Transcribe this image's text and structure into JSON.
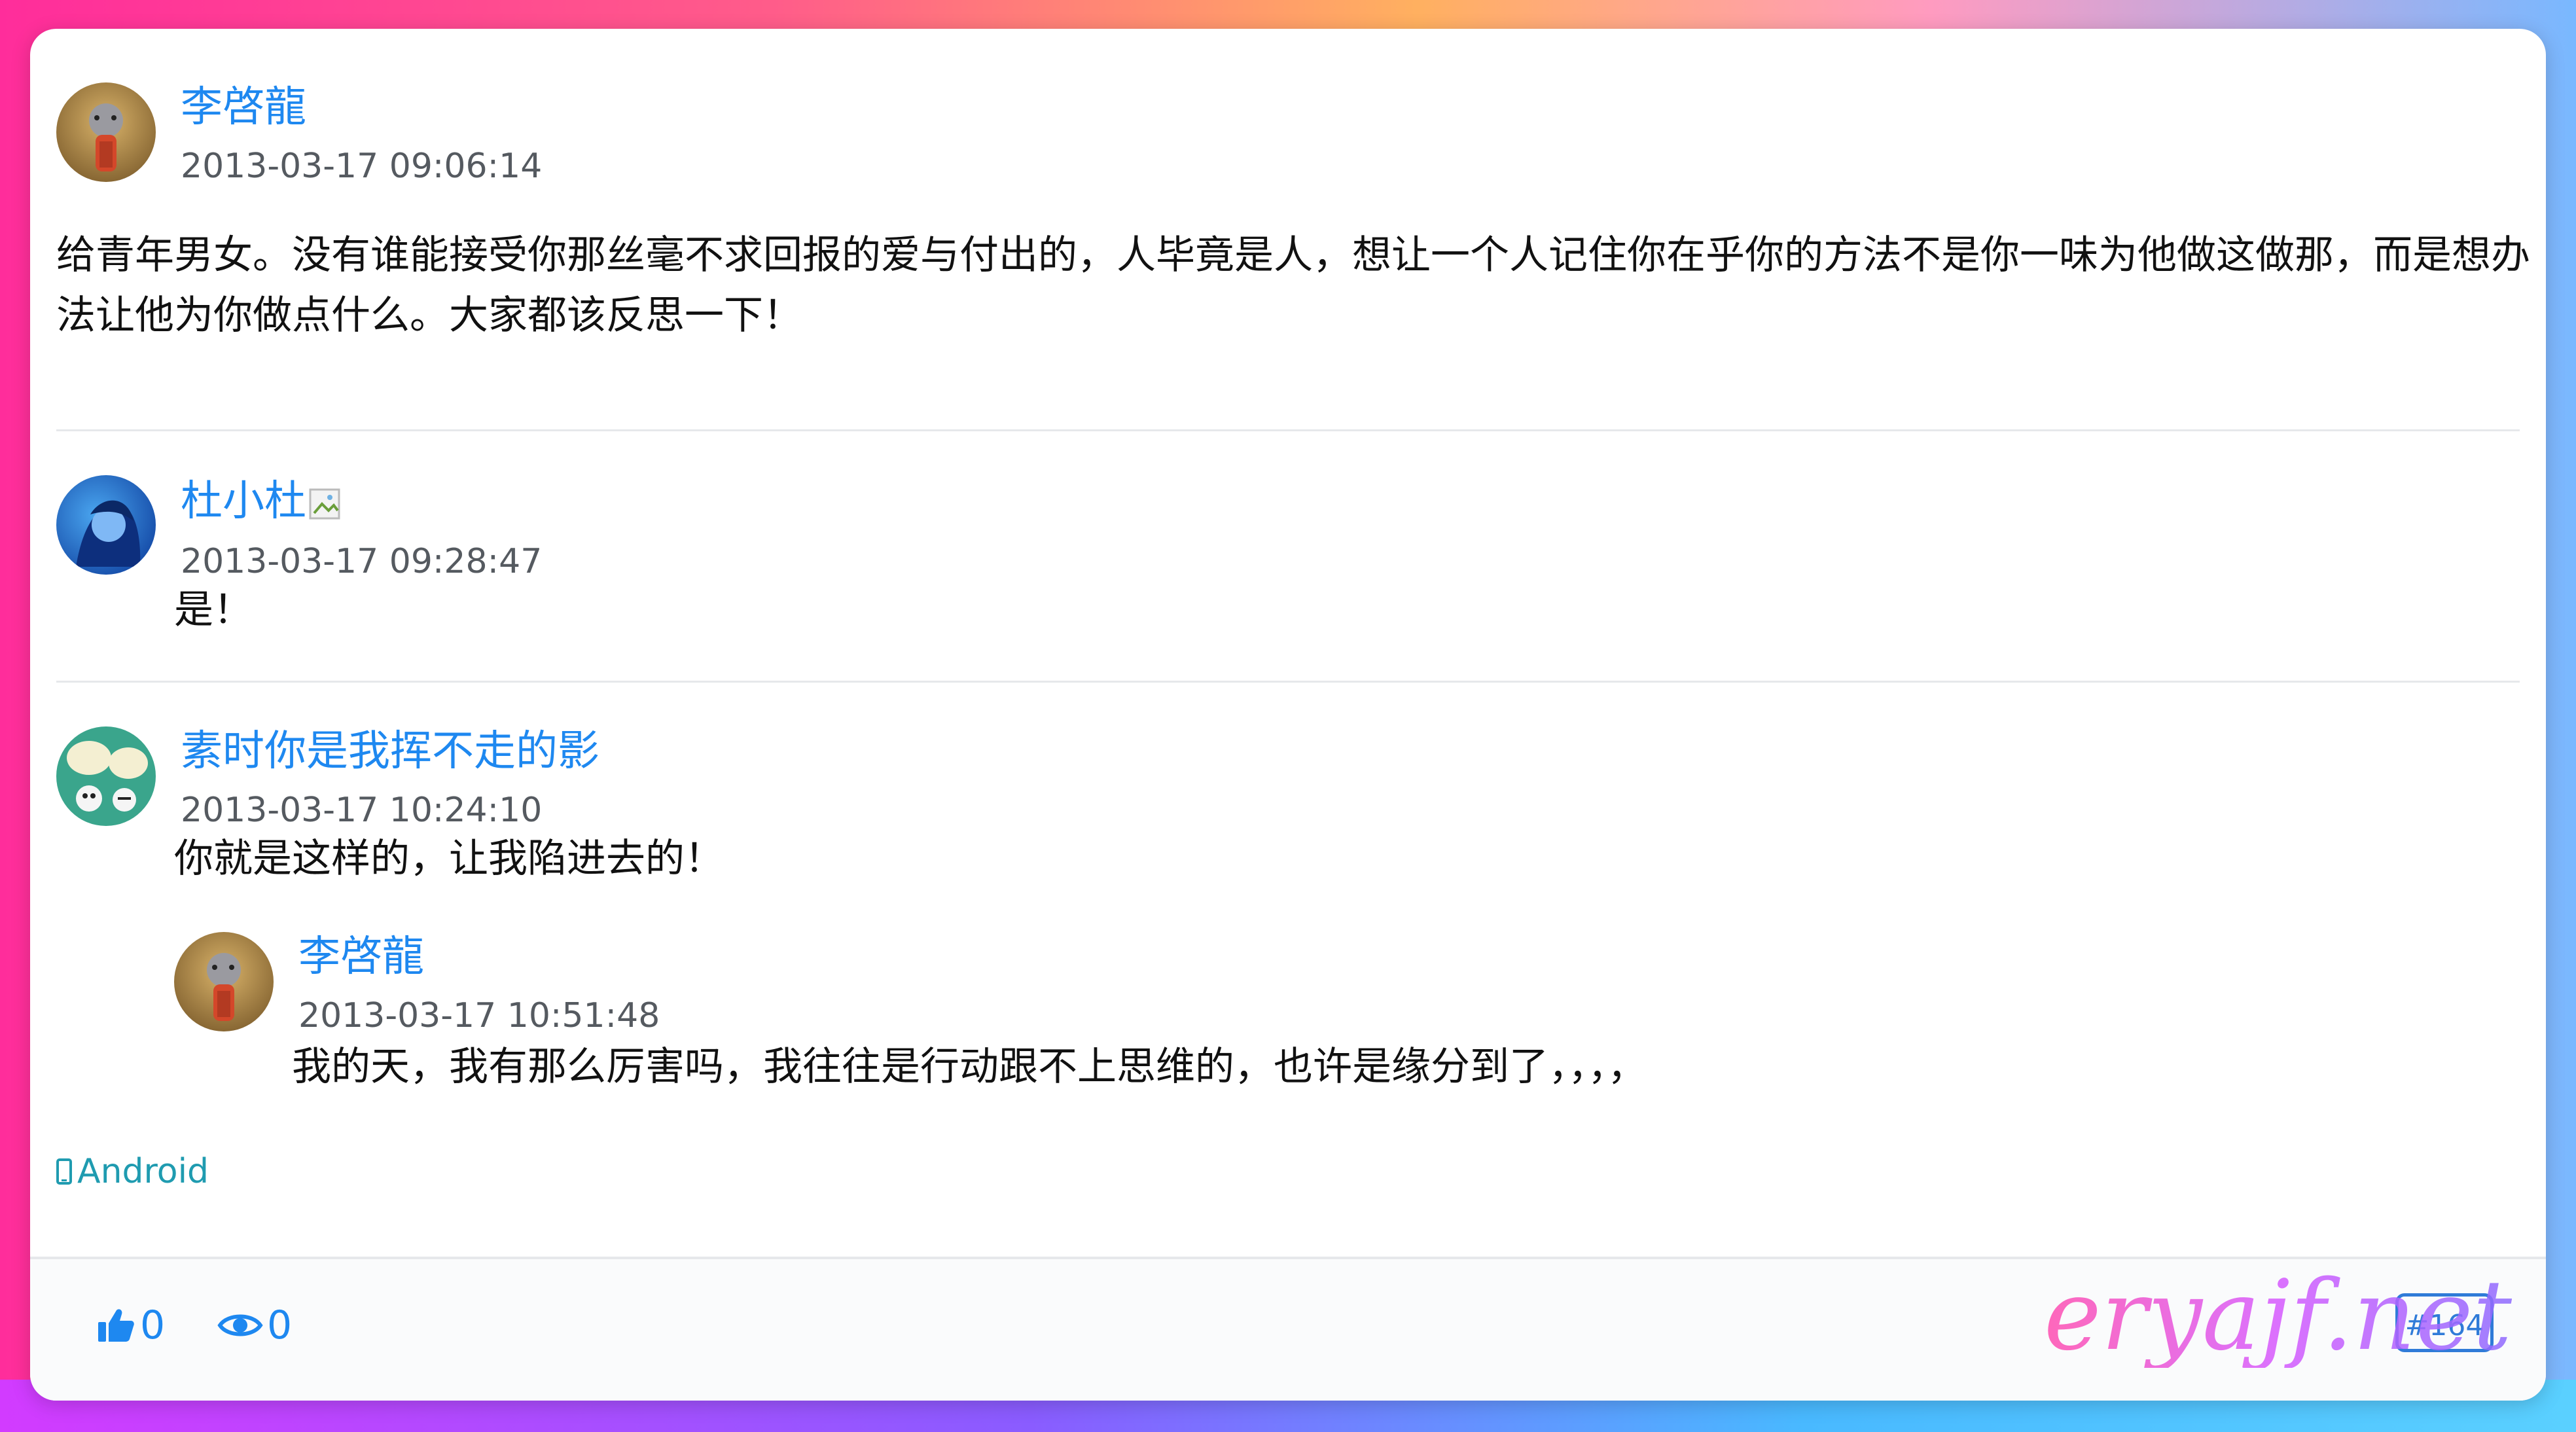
{
  "posts": [
    {
      "author": "李啓龍",
      "time": "2013-03-17 09:06:14",
      "text": "给青年男女。没有谁能接受你那丝毫不求回报的爱与付出的，人毕竟是人，想让一个人记住你在乎你的方法不是你一味为他做这做那，而是想办法让他为你做点什么。大家都该反思一下！",
      "avatar_icon": "dog-avatar-icon"
    },
    {
      "author": "杜小杜",
      "time": "2013-03-17 09:28:47",
      "text": "是！",
      "avatar_icon": "anime-avatar-icon"
    },
    {
      "author": "素时你是我挥不走的影",
      "time": "2013-03-17 10:24:10",
      "text": "你就是这样的，让我陷进去的！",
      "avatar_icon": "cartoon-avatar-icon"
    }
  ],
  "reply": {
    "author": "李啓龍",
    "time": "2013-03-17 10:51:48",
    "text": "我的天，我有那么厉害吗，我往往是行动跟不上思维的，也许是缘分到了，，，，",
    "avatar_icon": "dog-avatar-icon"
  },
  "device": {
    "label": "Android",
    "icon": "phone-icon"
  },
  "footer": {
    "likes": "0",
    "views": "0",
    "floor": "#164"
  },
  "watermark": "eryajf.net",
  "colors": {
    "link": "#1e88f0",
    "device": "#1f9bb0"
  }
}
